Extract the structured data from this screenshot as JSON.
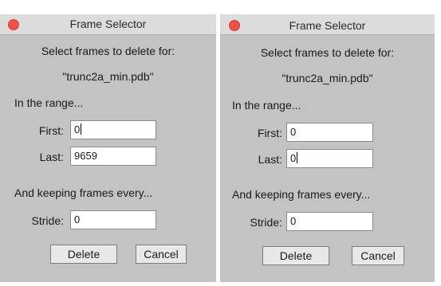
{
  "dialogs": [
    {
      "title": "Frame Selector",
      "prompt": "Select frames to delete for:",
      "filename": "\"trunc2a_min.pdb\"",
      "range_label": "In the range...",
      "first_label": "First:",
      "first_value": "0",
      "last_label": "Last:",
      "last_value": "9659",
      "keep_label": "And keeping frames every...",
      "stride_label": "Stride:",
      "stride_value": "0",
      "delete_label": "Delete",
      "cancel_label": "Cancel",
      "focused_field": "first"
    },
    {
      "title": "Frame Selector",
      "prompt": "Select frames to delete for:",
      "filename": "\"trunc2a_min.pdb\"",
      "range_label": "In the range...",
      "first_label": "First:",
      "first_value": "0",
      "last_label": "Last:",
      "last_value": "0",
      "keep_label": "And keeping frames every...",
      "stride_label": "Stride:",
      "stride_value": "0",
      "delete_label": "Delete",
      "cancel_label": "Cancel",
      "focused_field": "last"
    }
  ],
  "colors": {
    "window_bg": "#c3c3c3",
    "titlebar_bg": "#dcdcdc",
    "close_button": "#f0524a",
    "field_bg": "#ffffff",
    "button_bg": "#e8e8e8"
  },
  "icons": {
    "close": "close-icon"
  }
}
